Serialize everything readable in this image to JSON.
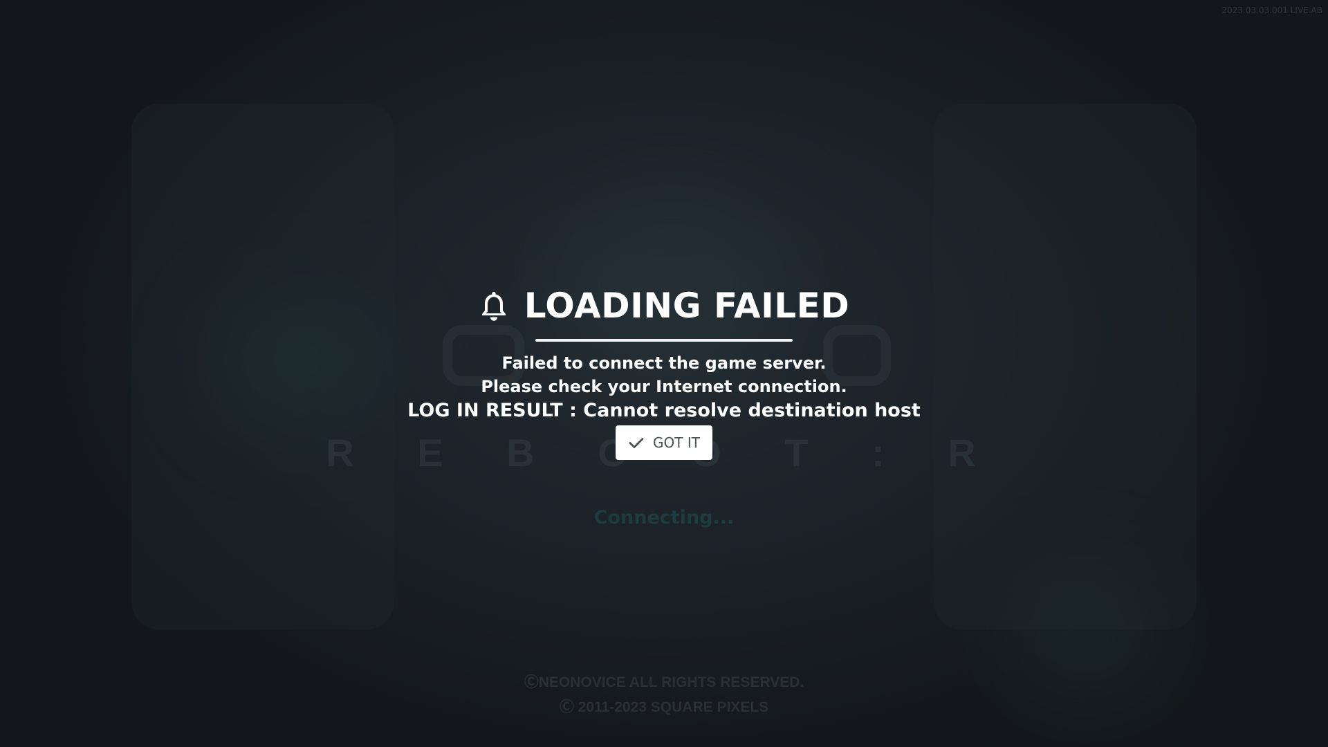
{
  "build_version": "2023.03.03.001 LIVE.AB",
  "dialog": {
    "title": "LOADING FAILED",
    "icon": "bell-icon",
    "message_line_1": "Failed to connect the game server.",
    "message_line_2": "Please check your Internet connection.",
    "login_result": "LOG IN RESULT : Cannot resolve destination host",
    "button": {
      "label": "GOT IT",
      "icon": "check-icon"
    }
  },
  "background": {
    "logo_subtitle": "R E B O O T : R",
    "status_text": "Connecting..."
  },
  "footer": {
    "copyright_1": "ⒸNEONOVICE ALL RIGHTS RESERVED.",
    "copyright_2": "Ⓒ 2011-2023 SQUARE PIXELS"
  },
  "colors": {
    "background": "#1a1f24",
    "dialog_text": "#ffffff",
    "button_bg": "#ffffff",
    "button_text": "#4a5158"
  }
}
